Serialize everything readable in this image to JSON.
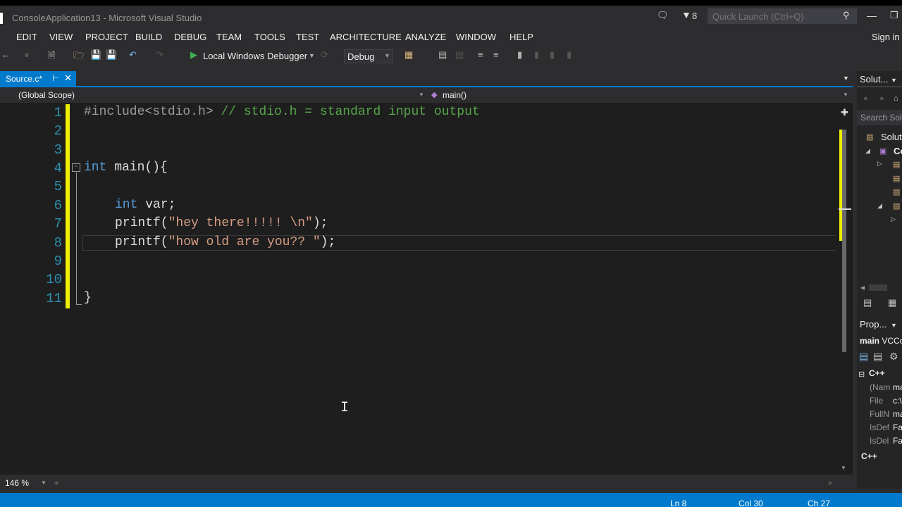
{
  "window": {
    "title": "ConsoleApplication13 - Microsoft Visual Studio",
    "notification_count": "8",
    "quick_launch_placeholder": "Quick Launch (Ctrl+Q)"
  },
  "menu": {
    "items": [
      "EDIT",
      "VIEW",
      "PROJECT",
      "BUILD",
      "DEBUG",
      "TEAM",
      "TOOLS",
      "TEST",
      "ARCHITECTURE",
      "ANALYZE",
      "WINDOW",
      "HELP"
    ],
    "sign_in": "Sign in"
  },
  "toolbar": {
    "start_debugging_label": "Local Windows Debugger",
    "configuration": "Debug"
  },
  "document_tab": {
    "label": "Source.c*"
  },
  "navigation": {
    "scope": "(Global Scope)",
    "member": "main()"
  },
  "editor": {
    "line_numbers": [
      "1",
      "2",
      "3",
      "4",
      "5",
      "6",
      "7",
      "8",
      "9",
      "10",
      "11"
    ],
    "code": {
      "l1_directive": "#include<stdio.h>",
      "l1_comment": " // stdio.h = standard input output",
      "l4_type": "int",
      "l4_rest": " main(){",
      "l6_type": "int",
      "l6_rest": " var;",
      "l7_func": "printf(",
      "l7_str": "\"hey there!!!!! \\n\"",
      "l7_end": ");",
      "l8_func": "printf(",
      "l8_str": "\"how old are you?? \"",
      "l8_end": ");",
      "l11": "}"
    },
    "zoom": "146 %"
  },
  "status": {
    "line": "Ln 8",
    "col": "Col 30",
    "ch": "Ch 27"
  },
  "solution_explorer": {
    "title": "Solut...",
    "search_placeholder": "Search Sol",
    "root_label": "Solut",
    "project_label": "Co"
  },
  "properties": {
    "title": "Prop...",
    "object_name": "main",
    "object_type": "VCCo",
    "category1": "C++",
    "rows": [
      {
        "name": "(Nam",
        "value": "ma"
      },
      {
        "name": "File",
        "value": "c:\\"
      },
      {
        "name": "FullN",
        "value": "ma"
      },
      {
        "name": "IsDef",
        "value": "Fa"
      },
      {
        "name": "IsDel",
        "value": "Fa"
      }
    ],
    "category2": "C++"
  },
  "colors": {
    "accent": "#007acc",
    "chrome_bg": "#2d2d30",
    "editor_bg": "#1e1e1e",
    "line_number": "#2b91af",
    "keyword": "#569cd6",
    "comment": "#57a64a",
    "string": "#d69d85",
    "change_marker": "#efef00"
  }
}
